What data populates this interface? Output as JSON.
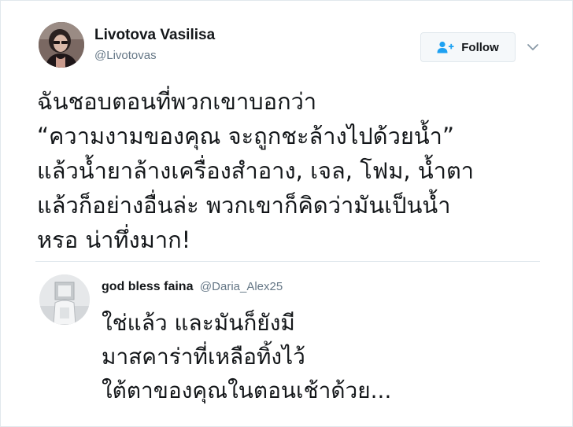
{
  "tweet": {
    "author": {
      "name": "Livotova Vasilisa",
      "handle": "@Livotovas",
      "avatar_icon": "user-avatar-photo"
    },
    "follow": {
      "label": "Follow",
      "icon": "follow-person-plus-icon",
      "accent": "#1da1f2"
    },
    "menu_icon": "chevron-down-icon",
    "text_lines": [
      "ฉันชอบตอนที่พวกเขาบอกว่า",
      "“ความงามของคุณ จะถูกชะล้างไปด้วยน้ำ”",
      "แล้วน้ำยาล้างเครื่องสำอาง, เจล, โฟม, น้ำตา",
      "แล้วก็อย่างอื่นล่ะ พวกเขาก็คิดว่ามันเป็นน้ำ",
      "หรอ น่าทึ่งมาก!"
    ]
  },
  "reply": {
    "author": {
      "name": "god bless faina",
      "handle": "@Daria_Alex25",
      "avatar_icon": "user-avatar-photo"
    },
    "text_lines": [
      "ใช่แล้ว และมันก็ยังมี",
      "มาสคาร่าที่เหลือทิ้งไว้",
      "ใต้ตาของคุณในตอนเช้าด้วย..."
    ]
  },
  "colors": {
    "text_primary": "#14171a",
    "text_secondary": "#657786",
    "border": "#e1e8ed",
    "button_bg": "#f5f8fa"
  }
}
